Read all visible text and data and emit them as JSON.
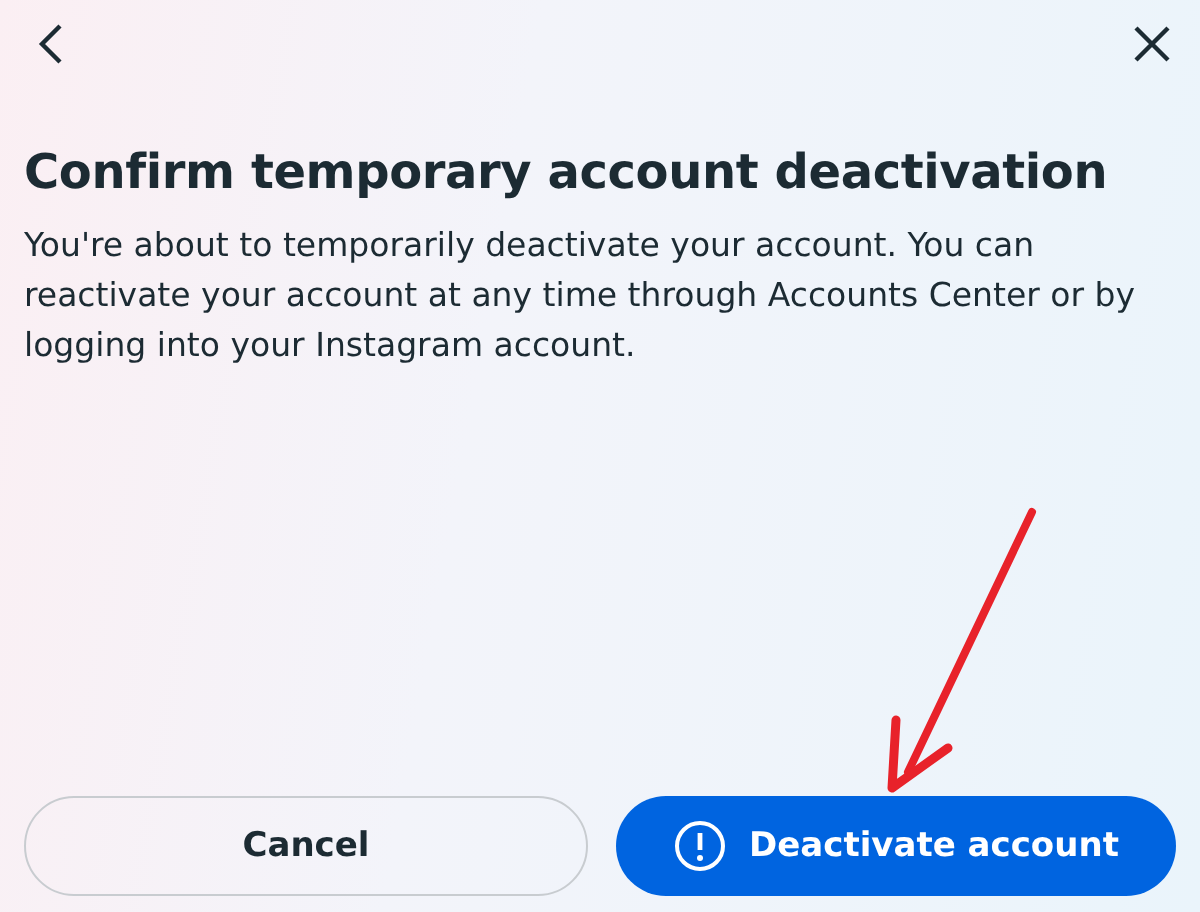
{
  "title": "Confirm temporary account deactivation",
  "body": "You're about to temporarily deactivate your account. You can reactivate your account at any time through Accounts Center or by logging into your Instagram account.",
  "buttons": [
    {
      "label": "Cancel",
      "kind": "secondary"
    },
    {
      "label": "Deactivate account",
      "kind": "primary"
    }
  ]
}
